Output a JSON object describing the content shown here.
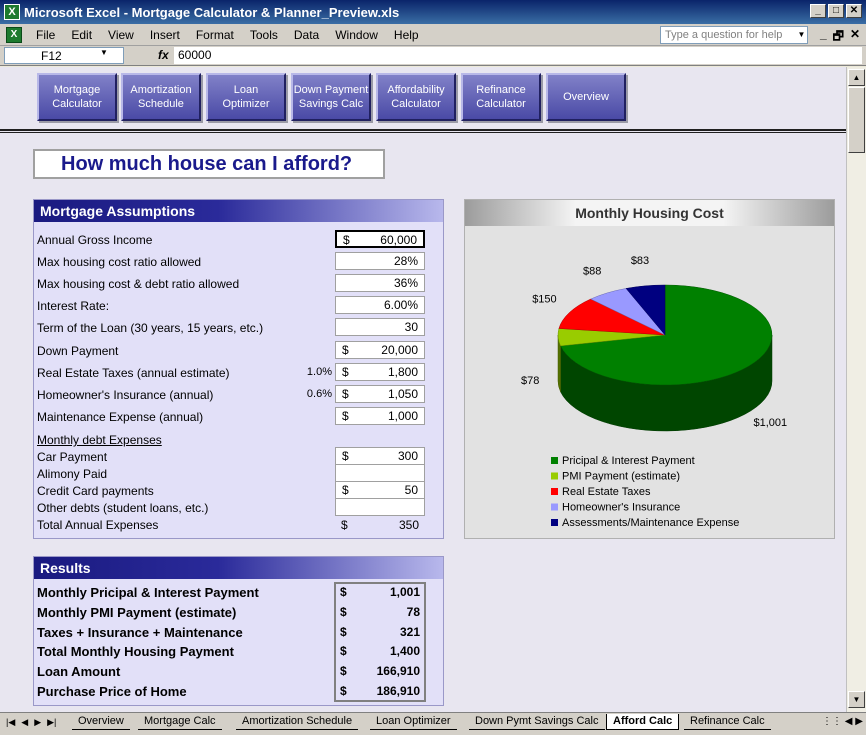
{
  "window": {
    "title": "Microsoft Excel - Mortgage Calculator & Planner_Preview.xls",
    "controls": [
      "_",
      "□",
      "✕"
    ]
  },
  "menu": {
    "items": [
      "File",
      "Edit",
      "View",
      "Insert",
      "Format",
      "Tools",
      "Data",
      "Window",
      "Help"
    ],
    "help_placeholder": "Type a question for help",
    "doc_controls": [
      "_",
      "🗗",
      "✕"
    ]
  },
  "formula_bar": {
    "cell_ref": "F12",
    "fx": "fx",
    "value": "60000"
  },
  "nav_buttons": [
    {
      "line1": "Mortgage",
      "line2": "Calculator"
    },
    {
      "line1": "Amortization",
      "line2": "Schedule"
    },
    {
      "line1": "Loan",
      "line2": "Optimizer"
    },
    {
      "line1": "Down Payment",
      "line2": "Savings Calc"
    },
    {
      "line1": "Affordability",
      "line2": "Calculator"
    },
    {
      "line1": "Refinance",
      "line2": "Calculator"
    },
    {
      "line1": "Overview",
      "line2": ""
    }
  ],
  "page_heading": "How much house can I afford?",
  "assumptions": {
    "title": "Mortgage Assumptions",
    "rows": [
      {
        "label": "Annual Gross Income",
        "pct": "",
        "prefix": "$",
        "value": "60,000"
      },
      {
        "label": "Max housing cost ratio allowed",
        "pct": "",
        "prefix": "",
        "value": "28%"
      },
      {
        "label": "Max housing cost & debt ratio allowed",
        "pct": "",
        "prefix": "",
        "value": "36%"
      },
      {
        "label": "Interest Rate:",
        "pct": "",
        "prefix": "",
        "value": "6.00%"
      },
      {
        "label": "Term of the Loan (30 years, 15 years, etc.)",
        "pct": "",
        "prefix": "",
        "value": "30"
      },
      {
        "label": "Down Payment",
        "pct": "",
        "prefix": "$",
        "value": "20,000"
      },
      {
        "label": "Real Estate Taxes (annual estimate)",
        "pct": "1.0%",
        "prefix": "$",
        "value": "1,800"
      },
      {
        "label": "Homeowner's Insurance (annual)",
        "pct": "0.6%",
        "prefix": "$",
        "value": "1,050"
      },
      {
        "label": "Maintenance Expense (annual)",
        "pct": "",
        "prefix": "$",
        "value": "1,000"
      }
    ],
    "debt_heading": "Monthly debt Expenses",
    "debts": [
      {
        "label": "Car Payment",
        "prefix": "$",
        "value": "300"
      },
      {
        "label": "Alimony Paid",
        "prefix": "",
        "value": ""
      },
      {
        "label": "Credit Card payments",
        "prefix": "$",
        "value": "50"
      },
      {
        "label": "Other debts (student loans, etc.)",
        "prefix": "",
        "value": ""
      }
    ],
    "total": {
      "label": "Total Annual Expenses",
      "prefix": "$",
      "value": "350"
    }
  },
  "results": {
    "title": "Results",
    "rows": [
      {
        "label": "Monthly Pricipal & Interest Payment",
        "prefix": "$",
        "value": "1,001"
      },
      {
        "label": "Monthly PMI Payment (estimate)",
        "prefix": "$",
        "value": "78"
      },
      {
        "label": "Taxes + Insurance + Maintenance",
        "prefix": "$",
        "value": "321"
      },
      {
        "label": "Total Monthly Housing Payment",
        "prefix": "$",
        "value": "1,400"
      },
      {
        "label": "Loan Amount",
        "prefix": "$",
        "value": "166,910"
      },
      {
        "label": "Purchase Price of Home",
        "prefix": "$",
        "value": "186,910"
      }
    ]
  },
  "chart_data": {
    "type": "pie",
    "title": "Monthly Housing Cost",
    "categories": [
      "Pricipal & Interest Payment",
      "PMI Payment (estimate)",
      "Real Estate Taxes",
      "Homeowner's Insurance",
      "Assessments/Maintenance Expense"
    ],
    "values": [
      1001,
      78,
      150,
      88,
      83
    ],
    "labels": [
      "$1,001",
      "$78",
      "$150",
      "$88",
      "$83"
    ],
    "colors": [
      "#008000",
      "#99cc00",
      "#ff0000",
      "#9999ff",
      "#000080"
    ],
    "legend_position": "bottom"
  },
  "tabs": {
    "items": [
      "Overview",
      "Mortgage Calc",
      "Amortization Schedule",
      "Loan Optimizer",
      "Down Pymt Savings Calc",
      "Afford Calc",
      "Refinance Calc"
    ],
    "active": "Afford Calc"
  }
}
